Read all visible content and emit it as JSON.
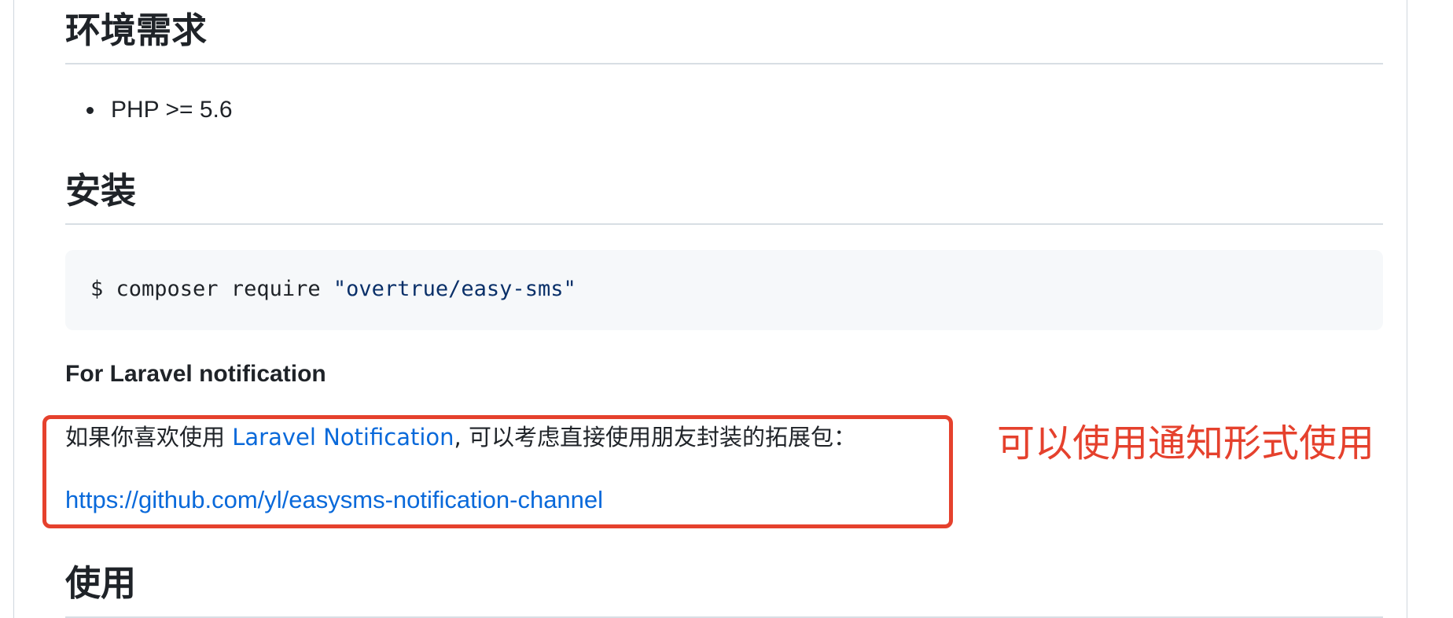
{
  "sections": {
    "requirements": {
      "heading": "环境需求",
      "items": [
        "PHP >= 5.6"
      ]
    },
    "installation": {
      "heading": "安装",
      "code": {
        "prefix": "$ composer require ",
        "string": "\"overtrue/easy-sms\""
      },
      "laravel": {
        "heading": "For Laravel notification",
        "para_before": "如果你喜欢使用 ",
        "para_link": "Laravel Notification",
        "para_after": ", 可以考虑直接使用朋友封装的拓展包：",
        "url": "https://github.com/yl/easysms-notification-channel"
      }
    },
    "usage": {
      "heading": "使用"
    }
  },
  "annotation": {
    "text": "可以使用通知形式使用",
    "color": "#e5412d"
  },
  "colors": {
    "link": "#0969da",
    "text": "#1f2328",
    "code_bg": "#f6f8fa"
  }
}
